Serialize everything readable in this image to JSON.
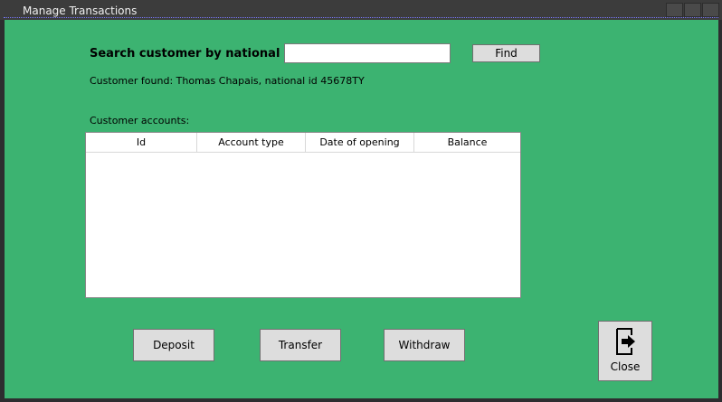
{
  "window": {
    "title": "Manage Transactions"
  },
  "search": {
    "label": "Search customer by national id:",
    "value": "",
    "placeholder": "",
    "find_label": "Find"
  },
  "customer": {
    "found_text": "Customer found: Thomas Chapais, national id 45678TY"
  },
  "accounts": {
    "label": "Customer accounts:",
    "columns": [
      "Id",
      "Account type",
      "Date of opening",
      "Balance"
    ],
    "rows": []
  },
  "actions": {
    "deposit_label": "Deposit",
    "transfer_label": "Transfer",
    "withdraw_label": "Withdraw",
    "close_label": "Close"
  },
  "colors": {
    "background": "#3cb371",
    "button": "#dddddd",
    "titlebar": "#3c3c3c"
  },
  "icons": {
    "close": "exit-door-icon"
  }
}
